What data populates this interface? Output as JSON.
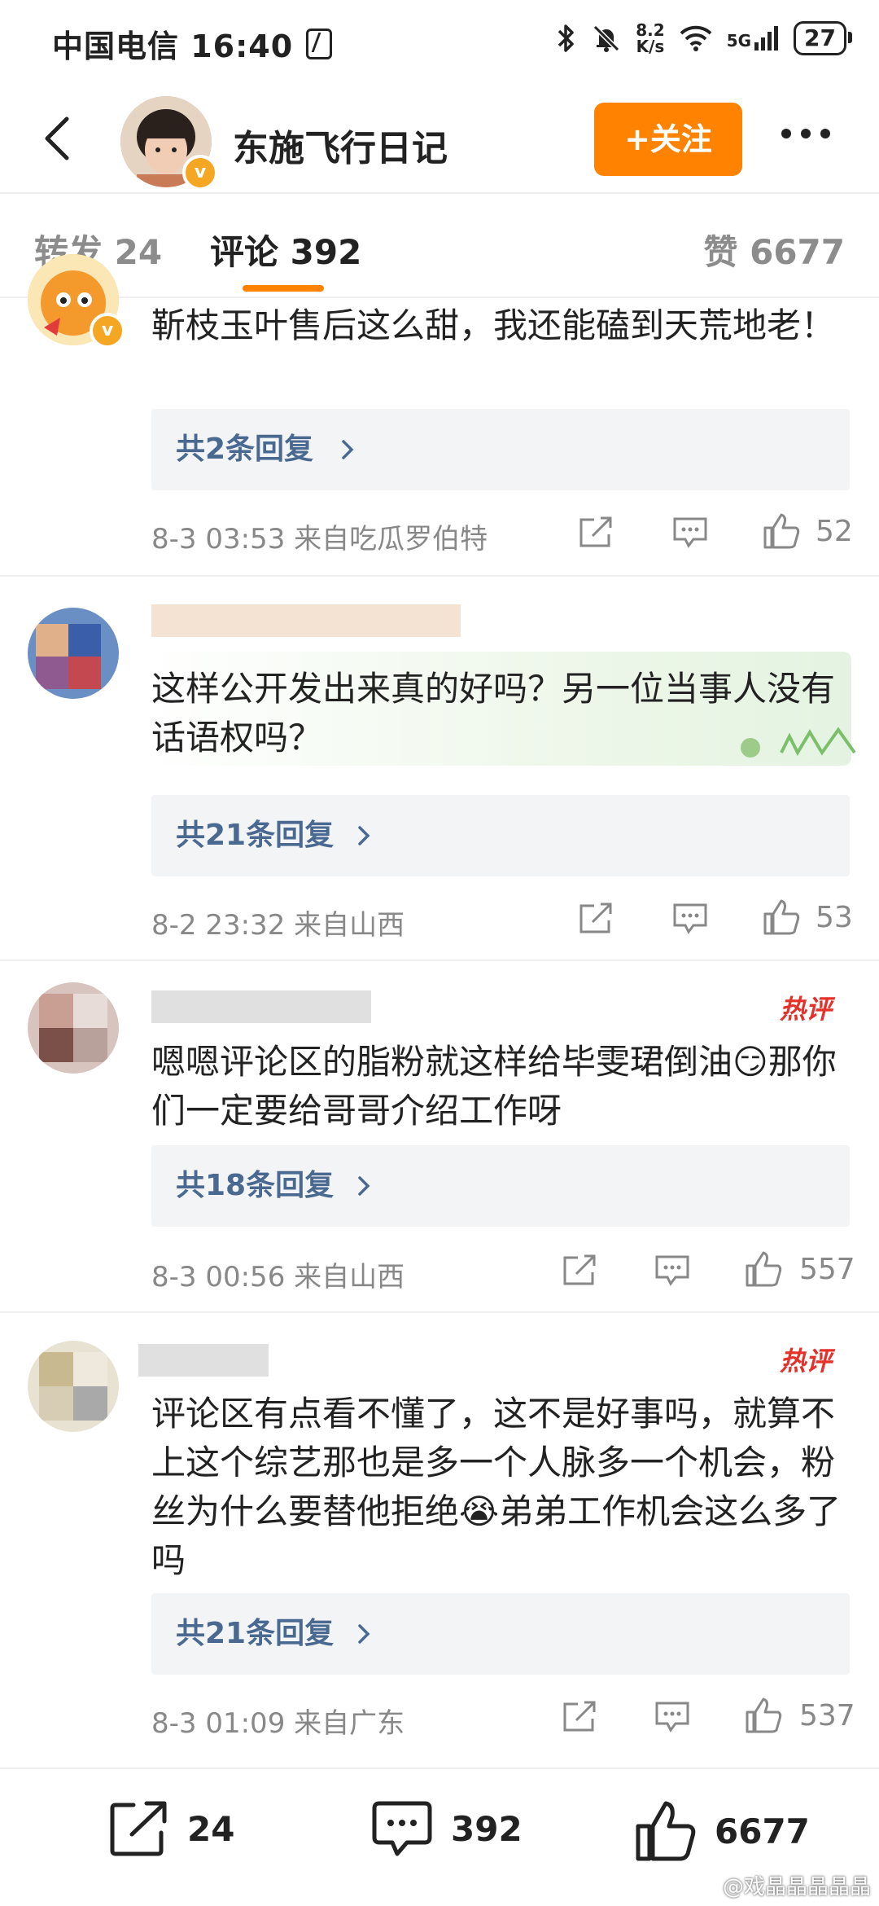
{
  "status_bar": {
    "carrier_time": "中国电信 16:40",
    "net_speed_value": "8.2",
    "net_speed_unit": "K/s",
    "network": "5G",
    "battery": "27"
  },
  "header": {
    "account_name": "东施飞行日记",
    "follow_label": "+关注"
  },
  "tabs": {
    "repost": "转发 24",
    "comments": "评论 392",
    "likes": "赞 6677"
  },
  "comments": [
    {
      "text": "靳枝玉叶售后这么甜，我还能磕到天荒地老！",
      "hot": "",
      "replies": "共2条回复",
      "meta": "8-3 03:53  来自吃瓜罗伯特",
      "likes": "52"
    },
    {
      "text": "这样公开发出来真的好吗？另一位当事人没有话语权吗？",
      "hot": "",
      "replies": "共21条回复",
      "meta": "8-2 23:32  来自山西",
      "likes": "53"
    },
    {
      "text": "嗯嗯评论区的脂粉就这样给毕雯珺倒油😏那你们一定要给哥哥介绍工作呀",
      "hot": "热评",
      "replies": "共18条回复",
      "meta": "8-3 00:56  来自山西",
      "likes": "557"
    },
    {
      "text": "评论区有点看不懂了，这不是好事吗，就算不上这个综艺那也是多一个人脉多一个机会，粉丝为什么要替他拒绝😭弟弟工作机会这么多了吗",
      "hot": "热评",
      "replies": "共21条回复",
      "meta": "8-3 01:09  来自广东",
      "likes": "537"
    }
  ],
  "bottom_bar": {
    "reposts": "24",
    "comments": "392",
    "likes": "6677"
  },
  "watermark": "@戏晶晶晶晶晶",
  "colors": {
    "accent_orange": "#ff8200",
    "reply_link": "#4a6991",
    "hot_red": "#e4322b",
    "meta_gray": "#888888"
  }
}
